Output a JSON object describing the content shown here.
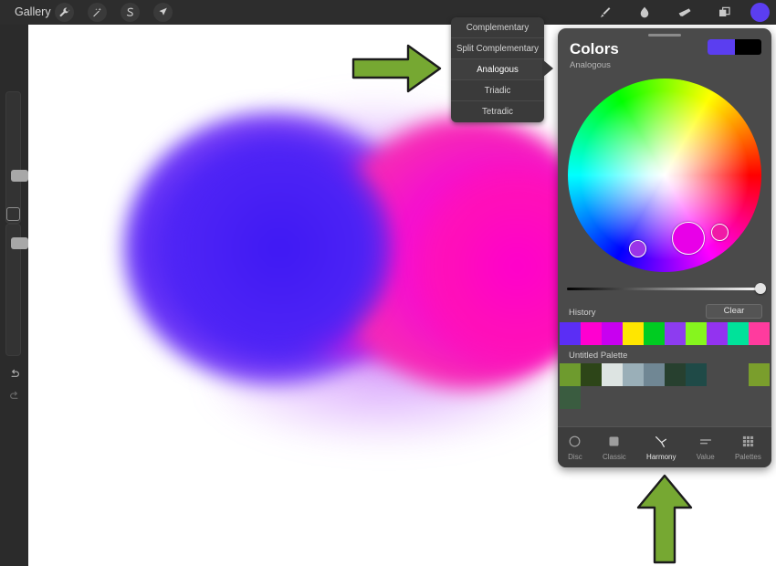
{
  "app": {
    "topbar": {
      "gallery_label": "Gallery",
      "left_icons": [
        {
          "name": "wrench-icon",
          "label": "Actions"
        },
        {
          "name": "magic-wand-icon",
          "label": "Adjustments"
        },
        {
          "name": "selection-s-icon",
          "label": "Selection"
        },
        {
          "name": "arrow-transform-icon",
          "label": "Transform"
        }
      ],
      "right_icons": [
        {
          "name": "paintbrush-icon",
          "label": "Paint"
        },
        {
          "name": "smudge-icon",
          "label": "Smudge"
        },
        {
          "name": "eraser-icon",
          "label": "Erase"
        },
        {
          "name": "layers-icon",
          "label": "Layers"
        }
      ],
      "primary_color": "#5b3ef0"
    },
    "sidebar": {
      "brush_size_label": "Brush Size",
      "brush_opacity_label": "Brush Opacity",
      "square_tool_label": "Modify",
      "undo_label": "Undo",
      "redo_label": "Redo"
    }
  },
  "harmony_menu": {
    "items": [
      {
        "label": "Complementary",
        "selected": false
      },
      {
        "label": "Split Complementary",
        "selected": false
      },
      {
        "label": "Analogous",
        "selected": true
      },
      {
        "label": "Triadic",
        "selected": false
      },
      {
        "label": "Tetradic",
        "selected": false
      }
    ]
  },
  "colors_panel": {
    "title": "Colors",
    "subtitle": "Analogous",
    "primary_swatch": "#5b3ef0",
    "secondary_swatch": "#000000",
    "wheel": {
      "main_marker_color": "#e800e8",
      "markers": 3
    },
    "value_slider": {
      "value": 100
    },
    "history": {
      "label": "History",
      "clear_label": "Clear",
      "swatches": [
        "#5b2ef5",
        "#ff00d0",
        "#c800f0",
        "#ffe600",
        "#00cc22",
        "#8d3cf0",
        "#86f51e",
        "#9333f0",
        "#00e29a",
        "#ff3b9e"
      ]
    },
    "palette": {
      "label": "Untitled Palette",
      "rows": [
        [
          "#6e9b2e",
          "#2d4518",
          "#dde4e2",
          "#9aafb8",
          "#708794",
          "#27402f",
          "#1f4a47",
          "",
          "",
          "#7a9e2c"
        ],
        [
          "#3a5c40",
          "",
          "",
          "",
          "",
          "",
          "",
          "",
          "",
          ""
        ]
      ]
    },
    "tabs": [
      {
        "label": "Disc",
        "icon": "circle-outline-icon",
        "active": false
      },
      {
        "label": "Classic",
        "icon": "square-filled-icon",
        "active": false
      },
      {
        "label": "Harmony",
        "icon": "harmony-branch-icon",
        "active": true
      },
      {
        "label": "Value",
        "icon": "value-lines-icon",
        "active": false
      },
      {
        "label": "Palettes",
        "icon": "grid-dots-icon",
        "active": false
      }
    ]
  },
  "annotations": {
    "arrow_color": "#76a832",
    "arrow_right_label": "points-to-analogous-menu-item",
    "arrow_up_label": "points-to-harmony-tab"
  }
}
